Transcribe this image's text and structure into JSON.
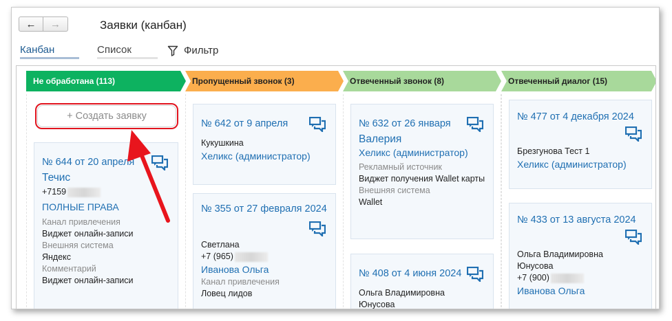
{
  "header": {
    "back_icon": "←",
    "forward_icon": "→",
    "title": "Заявки (канбан)"
  },
  "view_tabs": {
    "kanban": "Канбан",
    "list": "Список"
  },
  "filter": {
    "label": "Фильтр",
    "icon": "filter-icon"
  },
  "create_button": {
    "label": "+ Создать заявку"
  },
  "columns": [
    {
      "title": "Не обработана (113)",
      "color": "#0db260",
      "cards": [
        {
          "title": "№ 644 от 20 апреля",
          "name": "Течис",
          "phone": "+7159",
          "role": "ПОЛНЫЕ ПРАВА",
          "fields": [
            {
              "label": "Канал привлечения",
              "value": "Виджет онлайн-записи"
            },
            {
              "label": "Внешняя система",
              "value": "Яндекс"
            },
            {
              "label": "Комментарий",
              "value": "Виджет онлайн-записи"
            }
          ]
        }
      ]
    },
    {
      "title": "Пропущенный звонок (3)",
      "color": "#fbae4d",
      "cards": [
        {
          "title": "№ 642 от 9 апреля",
          "person": "Кукушкина",
          "manager": "Хеликс (администратор)"
        },
        {
          "title": "№ 355 от 27 февраля 2024",
          "person": "Светлана",
          "phone": "+7 (965)",
          "manager": "Иванова Ольга",
          "fields": [
            {
              "label": "Канал привлечения",
              "value": "Ловец лидов"
            }
          ]
        }
      ]
    },
    {
      "title": "Отвеченный звонок (8)",
      "color": "#a8d99b",
      "cards": [
        {
          "title": "№ 632 от 26 января",
          "name": "Валерия",
          "manager": "Хеликс (администратор)",
          "fields": [
            {
              "label": "Рекламный источник",
              "value": "Виджет получения Wallet карты"
            },
            {
              "label": "Внешняя система",
              "value": "Wallet"
            }
          ]
        },
        {
          "title": "№ 408 от 4 июня 2024",
          "person": "Ольга Владимировна Юнусова"
        }
      ]
    },
    {
      "title": "Отвеченный диалог (15)",
      "color": "#a8d99b",
      "cards": [
        {
          "title": "№ 477 от 4 декабря 2024",
          "person": "Брезгунова Тест 1",
          "manager": "Хеликс (администратор)"
        },
        {
          "title": "№ 433 от 13 августа 2024",
          "person": "Ольга Владимировна Юнусова",
          "phone": "+7 (900)",
          "manager": "Иванова Ольга"
        }
      ]
    }
  ]
}
